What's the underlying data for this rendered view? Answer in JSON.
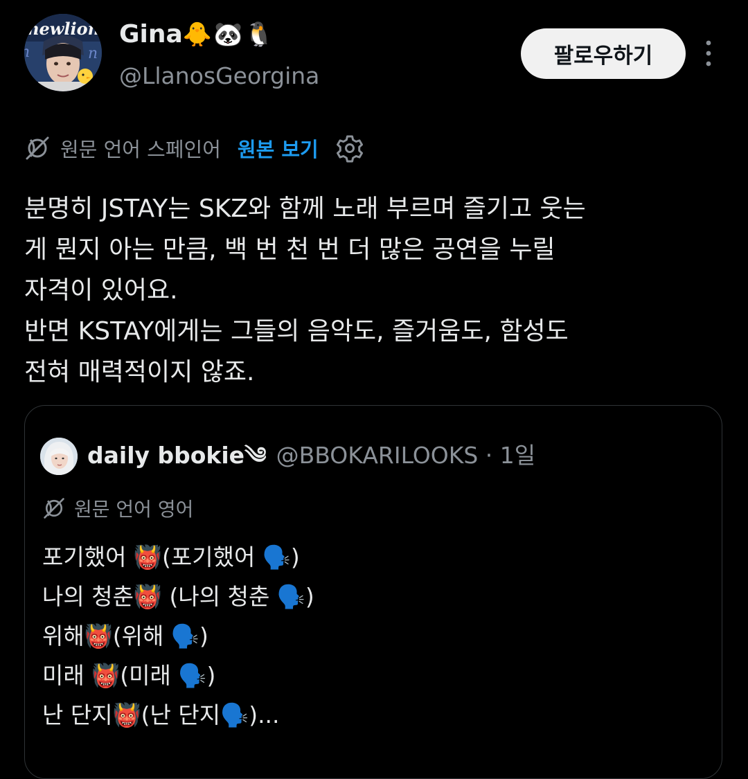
{
  "tweet": {
    "author": {
      "name": "Gina",
      "name_emojis": "🐥🐼🐧",
      "handle": "@LlanosGeorgina"
    },
    "follow_label": "팔로우하기",
    "more_icon": "more-vertical-icon",
    "translation": {
      "source_language_label": "원문 언어 스페인어",
      "show_original_label": "원본 보기",
      "settings_icon": "gear-icon"
    },
    "text_lines": [
      "분명히 JSTAY는 SKZ와 함께 노래 부르며 즐기고 웃는",
      "게 뭔지 아는 만큼, 백 번 천 번 더 많은 공연을 누릴",
      "자격이 있어요.",
      "반면 KSTAY에게는 그들의 음악도, 즐거움도, 함성도",
      "전혀 매력적이지 않죠."
    ]
  },
  "quoted_tweet": {
    "author_name": "daily bbokie༄",
    "handle_time": "@BBOKARILOOKS · 1일",
    "source_language_label": "원문 언어 영어",
    "text_lines": [
      "포기했어 👹(포기했어 🗣️)",
      "나의 청춘👹 (나의 청춘 🗣️)",
      "위해👹(위해 🗣️)",
      "미래 👹(미래 🗣️)",
      "난 단지👹(난 단지🗣️)..."
    ]
  },
  "colors": {
    "background": "#000000",
    "text_primary": "#e7e9ea",
    "text_secondary": "#8b9198",
    "link_blue": "#1d9bf0",
    "follow_button_bg": "#f1f1f1",
    "card_border": "#2f3336"
  }
}
